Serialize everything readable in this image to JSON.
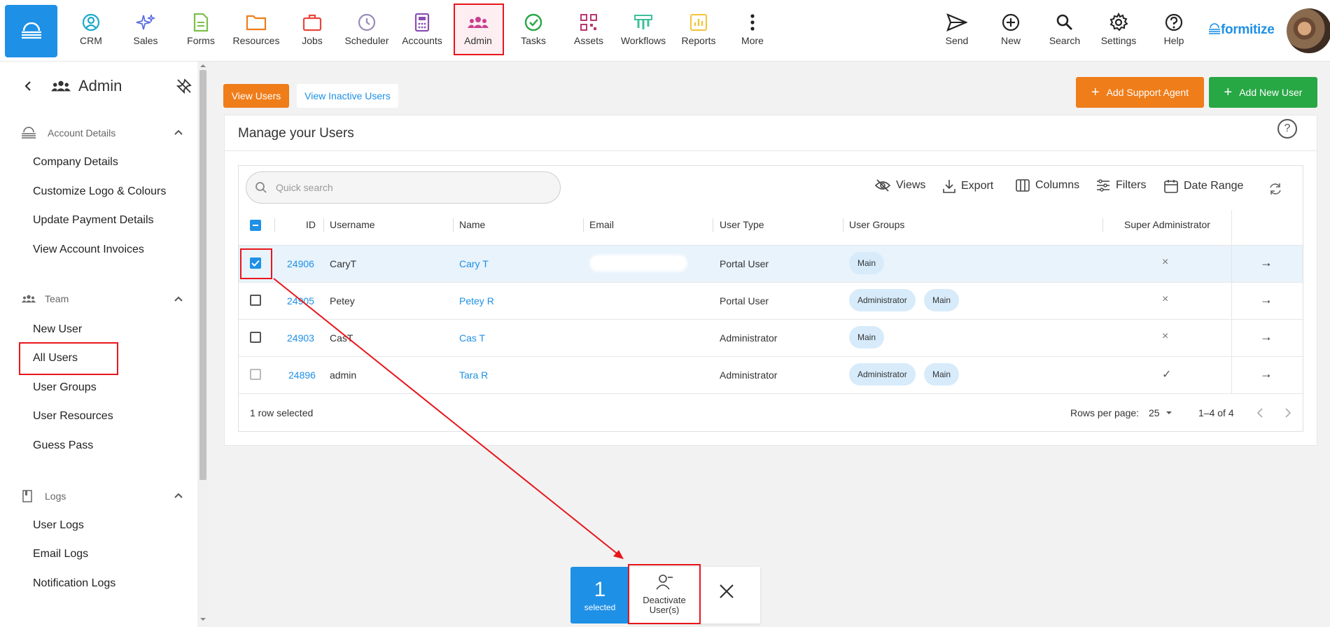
{
  "nav": {
    "items": [
      {
        "label": "CRM",
        "icon": "crm-icon",
        "color": "#1aa9c9"
      },
      {
        "label": "Sales",
        "icon": "sparkle-icon",
        "color": "#5b6ee1"
      },
      {
        "label": "Forms",
        "icon": "form-icon",
        "color": "#7cbf4a"
      },
      {
        "label": "Resources",
        "icon": "folder-icon",
        "color": "#ef7d1a"
      },
      {
        "label": "Jobs",
        "icon": "briefcase-icon",
        "color": "#e8463d"
      },
      {
        "label": "Scheduler",
        "icon": "clock-icon",
        "color": "#9a8ab8"
      },
      {
        "label": "Accounts",
        "icon": "calculator-icon",
        "color": "#8a4fb3"
      },
      {
        "label": "Admin",
        "icon": "users-icon",
        "color": "#c9408f"
      },
      {
        "label": "Tasks",
        "icon": "check-circle-icon",
        "color": "#28a745"
      },
      {
        "label": "Assets",
        "icon": "qr-icon",
        "color": "#b9366e"
      },
      {
        "label": "Workflows",
        "icon": "workflow-icon",
        "color": "#3fbf9a"
      },
      {
        "label": "Reports",
        "icon": "chart-icon",
        "color": "#f2c43a"
      },
      {
        "label": "More",
        "icon": "more-vertical-icon",
        "color": "#333333"
      }
    ],
    "right_items": [
      {
        "label": "Send",
        "icon": "send-icon"
      },
      {
        "label": "New",
        "icon": "plus-circle-icon"
      },
      {
        "label": "Search",
        "icon": "search-icon"
      },
      {
        "label": "Settings",
        "icon": "gear-icon"
      },
      {
        "label": "Help",
        "icon": "help-icon"
      }
    ],
    "brand": "formitize"
  },
  "sidebar": {
    "title": "Admin",
    "sections": [
      {
        "label": "Account Details",
        "icon": "cloud-icon",
        "items": [
          "Company Details",
          "Customize Logo & Colours",
          "Update Payment Details",
          "View Account Invoices"
        ]
      },
      {
        "label": "Team",
        "icon": "team-icon",
        "items": [
          "New User",
          "All Users",
          "User Groups",
          "User Resources",
          "Guess Pass"
        ]
      },
      {
        "label": "Logs",
        "icon": "book-icon",
        "items": [
          "User Logs",
          "Email Logs",
          "Notification Logs"
        ]
      }
    ]
  },
  "tabs": {
    "active": "View Users",
    "inactive": "View Inactive Users"
  },
  "actions": {
    "support": "Add Support Agent",
    "new_user": "Add New User"
  },
  "card": {
    "title": "Manage your Users",
    "help": "?"
  },
  "toolbar": {
    "search_placeholder": "Quick search",
    "views": "Views",
    "export": "Export",
    "columns": "Columns",
    "filters": "Filters",
    "date_range": "Date Range"
  },
  "table": {
    "columns": [
      "ID",
      "Username",
      "Name",
      "Email",
      "User Type",
      "User Groups",
      "Super Administrator"
    ],
    "rows": [
      {
        "id": "24906",
        "username": "CaryT",
        "name": "Cary T",
        "email": "",
        "user_type": "Portal User",
        "groups": [
          "Main"
        ],
        "super": "×",
        "selected": true
      },
      {
        "id": "24905",
        "username": "Petey",
        "name": "Petey R",
        "email": "",
        "user_type": "Portal User",
        "groups": [
          "Administrator",
          "Main"
        ],
        "super": "×",
        "selected": false
      },
      {
        "id": "24903",
        "username": "CasT",
        "name": "Cas T",
        "email": "",
        "user_type": "Administrator",
        "groups": [
          "Main"
        ],
        "super": "×",
        "selected": false
      },
      {
        "id": "24896",
        "username": "admin",
        "name": "Tara R",
        "email": "",
        "user_type": "Administrator",
        "groups": [
          "Administrator",
          "Main"
        ],
        "super": "✓",
        "selected": false
      }
    ],
    "row_arrow": "→"
  },
  "footer": {
    "selected_text": "1 row selected",
    "rows_per_page_label": "Rows per page:",
    "rows_per_page": "25",
    "range": "1–4 of 4"
  },
  "bulk_bar": {
    "count": "1",
    "count_label": "selected",
    "deactivate_line1": "Deactivate",
    "deactivate_line2": "User(s)"
  },
  "colors": {
    "accent": "#1e90e6",
    "orange": "#ef7d1a",
    "green": "#28a745",
    "highlight": "#e8161c"
  }
}
